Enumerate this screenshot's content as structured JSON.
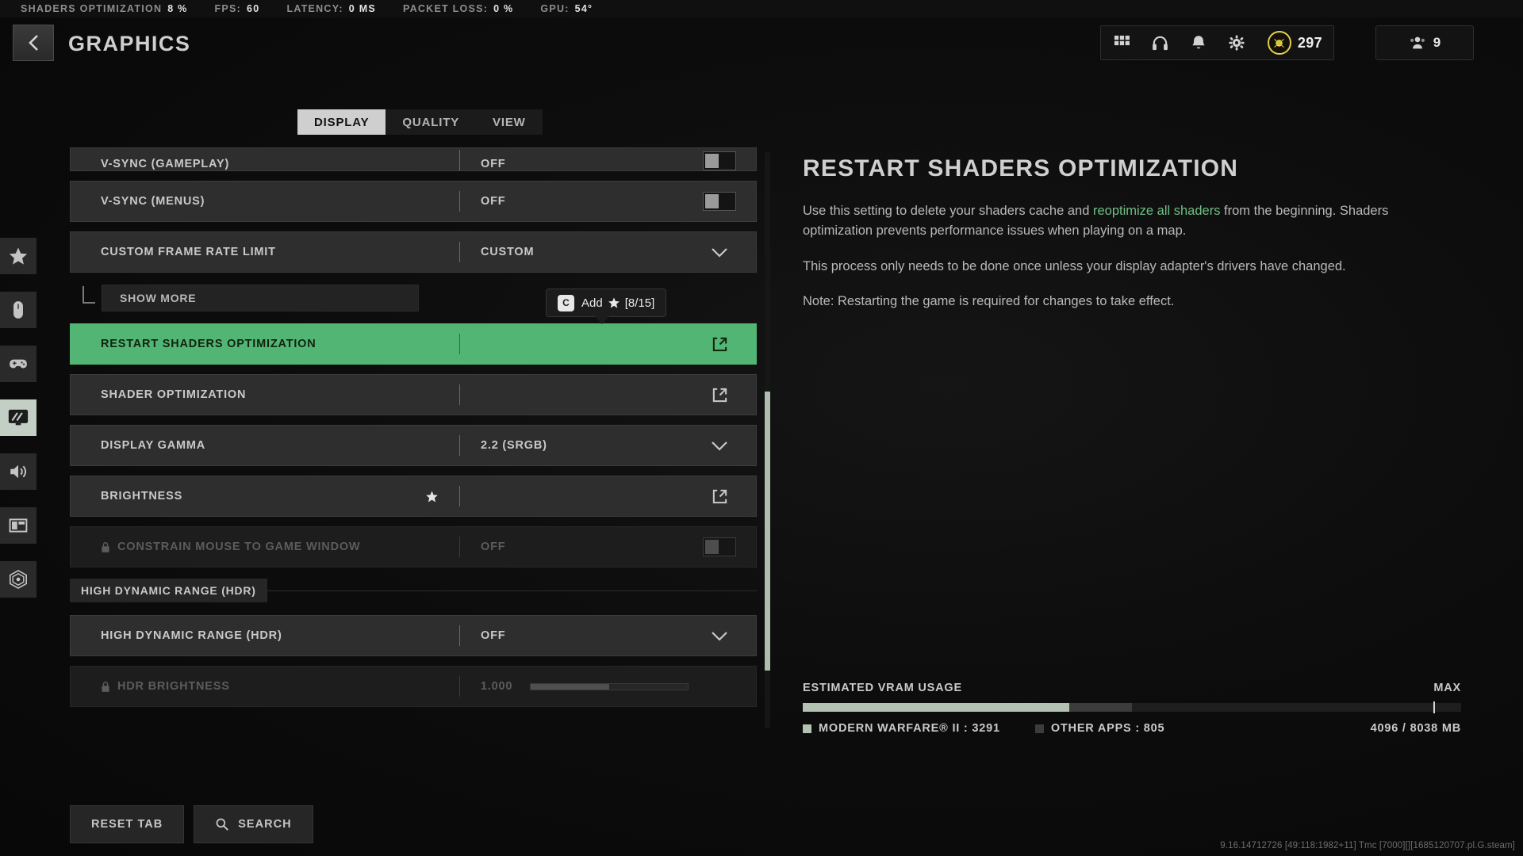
{
  "perf": {
    "items": [
      {
        "label": "SHADERS OPTIMIZATION",
        "value": "8 %"
      },
      {
        "label": "FPS:",
        "value": "60"
      },
      {
        "label": "LATENCY:",
        "value": "0 MS"
      },
      {
        "label": "PACKET LOSS:",
        "value": "0 %"
      },
      {
        "label": "GPU:",
        "value": "54°"
      }
    ]
  },
  "header": {
    "title": "GRAPHICS",
    "back_icon": "chevron-left-icon",
    "icons": [
      "grid-icon",
      "headset-icon",
      "bell-icon",
      "gear-icon"
    ],
    "currency": "297",
    "friends_count": "9"
  },
  "rail": {
    "items": [
      {
        "name": "favorites",
        "icon": "star-icon",
        "active": false
      },
      {
        "name": "mouse-keyboard",
        "icon": "mouse-icon",
        "active": false
      },
      {
        "name": "controller",
        "icon": "gamepad-icon",
        "active": false
      },
      {
        "name": "graphics",
        "icon": "monitor-icon",
        "active": true
      },
      {
        "name": "audio",
        "icon": "speaker-icon",
        "active": false
      },
      {
        "name": "interface",
        "icon": "layout-icon",
        "active": false
      },
      {
        "name": "account-network",
        "icon": "broadcast-icon",
        "active": false
      }
    ]
  },
  "tabs": [
    {
      "label": "DISPLAY",
      "active": true
    },
    {
      "label": "QUALITY",
      "active": false
    },
    {
      "label": "VIEW",
      "active": false
    }
  ],
  "settings": {
    "rows": [
      {
        "label": "V-SYNC (GAMEPLAY)",
        "value": "OFF",
        "control": "toggle",
        "partial": true
      },
      {
        "label": "V-SYNC (MENUS)",
        "value": "OFF",
        "control": "toggle"
      },
      {
        "label": "CUSTOM FRAME RATE LIMIT",
        "value": "CUSTOM",
        "control": "dropdown"
      },
      {
        "label": "SHOW MORE",
        "control": "showmore"
      },
      {
        "label": "RESTART SHADERS OPTIMIZATION",
        "value": "",
        "control": "link",
        "highlighted": true
      },
      {
        "label": "SHADER OPTIMIZATION",
        "value": "",
        "control": "link"
      },
      {
        "label": "DISPLAY GAMMA",
        "value": "2.2 (SRGB)",
        "control": "dropdown"
      },
      {
        "label": "BRIGHTNESS",
        "value": "",
        "control": "link",
        "favorited": true
      },
      {
        "label": "CONSTRAIN MOUSE TO GAME WINDOW",
        "value": "OFF",
        "control": "toggle",
        "locked": true,
        "disabled": true
      },
      {
        "label": "HIGH DYNAMIC RANGE (HDR)",
        "control": "section"
      },
      {
        "label": "HIGH DYNAMIC RANGE (HDR)",
        "value": "OFF",
        "control": "dropdown"
      },
      {
        "label": "HDR BRIGHTNESS",
        "value": "1.000",
        "control": "slider",
        "locked": true,
        "disabled": true,
        "slider_pct": 50
      }
    ]
  },
  "tooltip": {
    "key": "C",
    "action": "Add",
    "star_icon": "star-icon",
    "count": "[8/15]"
  },
  "detail": {
    "title": "RESTART SHADERS OPTIMIZATION",
    "p1_a": "Use this setting to delete your shaders cache and ",
    "p1_hl": "reoptimize all shaders",
    "p1_b": " from the beginning. Shaders optimization prevents performance issues when playing on a map.",
    "p2": "This process only needs to be done once unless your display adapter's drivers have changed.",
    "p3": "Note: Restarting the game is required for changes to take effect."
  },
  "vram": {
    "title": "ESTIMATED VRAM USAGE",
    "max_label": "MAX",
    "legend_game": "MODERN WARFARE® II : 3291",
    "legend_other": "OTHER APPS : 805",
    "capacity": "4096 / 8038 MB"
  },
  "footer": {
    "reset_label": "RESET TAB",
    "search_label": "SEARCH",
    "search_icon": "magnifier-icon",
    "version": "9.16.14712726 [49:118:1982+11] Tmc [7000][][1685120707.pl.G.steam]"
  },
  "colors": {
    "accent_green": "#53b574",
    "link_green": "#6fbe84",
    "currency_gold": "#e3d24a",
    "vram_game": "#b3c2b3"
  }
}
